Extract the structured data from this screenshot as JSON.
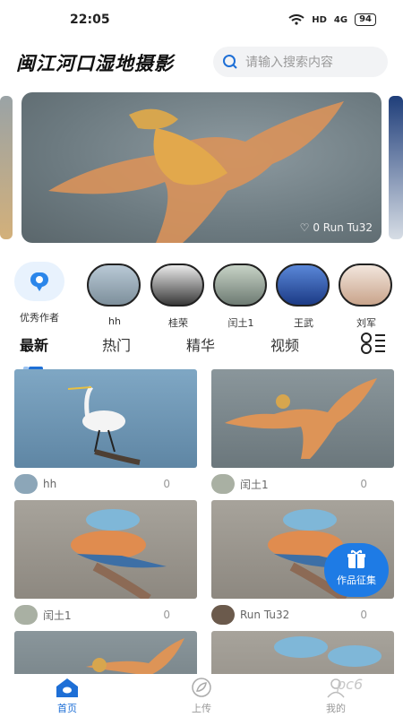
{
  "status_bar": {
    "time": "22:05",
    "network": "HD",
    "signal": "4G",
    "battery": "94"
  },
  "header": {
    "title": "闽江河口湿地摄影",
    "search_placeholder": "请输入搜索内容"
  },
  "banner": {
    "caption": "0 Run Tu32"
  },
  "authors": {
    "feature_label": "优秀作者",
    "items": [
      {
        "name": "hh"
      },
      {
        "name": "桂荣"
      },
      {
        "name": "闰土1"
      },
      {
        "name": "王武"
      },
      {
        "name": "刘军"
      }
    ]
  },
  "tabs": [
    {
      "label": "最新",
      "active": true
    },
    {
      "label": "热门",
      "active": false
    },
    {
      "label": "精华",
      "active": false
    },
    {
      "label": "视频",
      "active": false
    }
  ],
  "posts": [
    {
      "author": "hh",
      "count": "0",
      "photo": "egret-on-water"
    },
    {
      "author": "闰土1",
      "count": "0",
      "photo": "orange-bird-flight"
    },
    {
      "author": "闰土1",
      "count": "0",
      "photo": "rollers-pair"
    },
    {
      "author": "Run Tu32",
      "count": "0",
      "photo": "rollers-pair"
    },
    {
      "author": "",
      "count": "",
      "photo": "orange-bird-flight"
    },
    {
      "author": "",
      "count": "",
      "photo": "rollers-pair"
    }
  ],
  "float_button": {
    "label": "作品征集",
    "icon": "gift-icon"
  },
  "bottom_nav": [
    {
      "label": "首页",
      "icon": "home-icon",
      "active": true
    },
    {
      "label": "上传",
      "icon": "upload-icon",
      "active": false
    },
    {
      "label": "我的",
      "icon": "profile-icon",
      "active": false
    }
  ],
  "watermark": "pc6",
  "colors": {
    "accent": "#1e6fd6",
    "float_button": "#1e7be5",
    "search_bg": "#f2f3f5"
  }
}
